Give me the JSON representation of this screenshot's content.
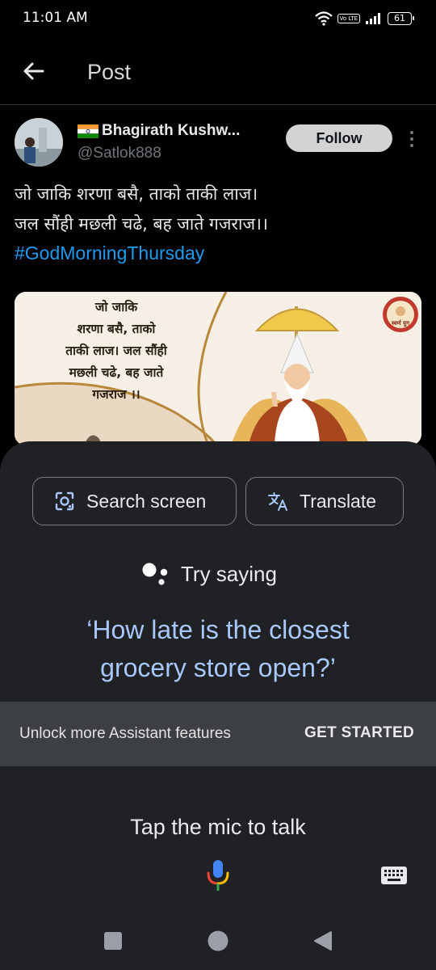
{
  "status_bar": {
    "time": "11:01 AM",
    "network_badge": "Vo LTE",
    "battery": "61"
  },
  "header": {
    "title": "Post"
  },
  "post": {
    "author_name": "Bhagirath Kushw...",
    "author_handle": "@Satlok888",
    "follow_label": "Follow",
    "text_line_1": "जो जाकि शरणा बसै, ताको ताकी लाज।",
    "text_line_2": "जल सौंही मछली चढे, बह जाते गजराज।।",
    "hashtag": "#GodMorningThursday",
    "image_text": {
      "line_1": "जो जाकि",
      "line_2": "शरणा बसै, ताको",
      "line_3": "ताकी लाज। जल सौंही",
      "line_4": "मछली चढे, बह जाते",
      "line_5": "गजराज ।।"
    },
    "image_logo_text": "स्वर्ण युग"
  },
  "assistant": {
    "search_screen_label": "Search screen",
    "translate_label": "Translate",
    "try_saying_label": "Try saying",
    "suggestion_line_1": "‘How late is the closest",
    "suggestion_line_2": "grocery store open?’",
    "unlock_text": "Unlock more Assistant features",
    "get_started_label": "GET STARTED",
    "tap_mic_label": "Tap the mic to talk"
  },
  "colors": {
    "background": "#000000",
    "sheet": "#202124",
    "hashtag": "#1d9bf0",
    "suggestion": "#a8c7fa",
    "unlock_bar": "#3c4043"
  }
}
